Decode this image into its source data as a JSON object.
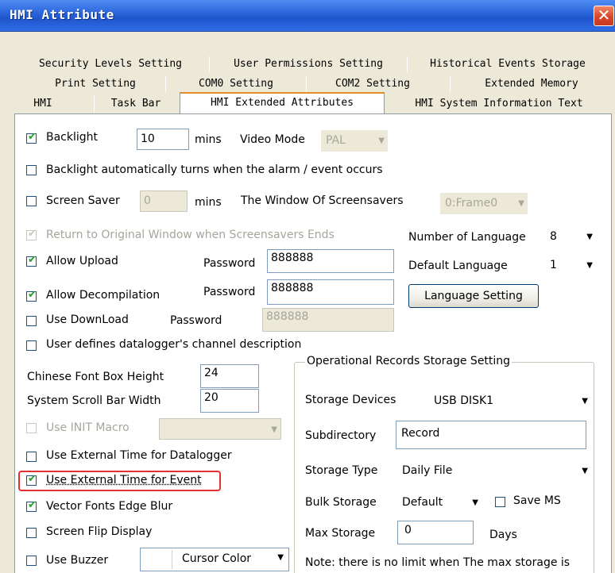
{
  "window": {
    "title": "HMI Attribute",
    "close_glyph": "✕"
  },
  "tabs": {
    "row1": [
      "Security Levels Setting",
      "User Permissions Setting",
      "Historical Events Storage"
    ],
    "row2": [
      "Print Setting",
      "COM0 Setting",
      "COM2 Setting",
      "Extended Memory"
    ],
    "row3": [
      "HMI",
      "Task Bar",
      "HMI Extended Attributes",
      "HMI System Information Text"
    ],
    "active": "HMI Extended Attributes"
  },
  "form": {
    "backlight": {
      "label": "Backlight",
      "checked": true,
      "value": "10",
      "unit": "mins"
    },
    "video_mode": {
      "label": "Video Mode",
      "value": "PAL"
    },
    "backlight_alarm": {
      "label": "Backlight automatically turns when the alarm / event occurs",
      "checked": false
    },
    "screen_saver": {
      "label": "Screen Saver",
      "checked": false,
      "value": "0",
      "unit": "mins"
    },
    "window_of_screensavers": {
      "label": "The Window Of Screensavers",
      "value": "0:Frame0"
    },
    "return_original": {
      "label": "Return to Original Window when Screensavers Ends",
      "checked": true
    },
    "number_of_language": {
      "label": "Number of Language",
      "value": "8"
    },
    "allow_upload": {
      "label": "Allow Upload",
      "checked": true,
      "password_label": "Password",
      "password": "888888"
    },
    "default_language": {
      "label": "Default Language",
      "value": "1"
    },
    "allow_decompilation": {
      "label": "Allow Decompilation",
      "checked": true,
      "password_label": "Password",
      "password": "888888"
    },
    "language_setting_button": "Language Setting",
    "use_download": {
      "label": "Use DownLoad",
      "checked": false,
      "password_label": "Password",
      "password": "888888"
    },
    "datalogger_channel": {
      "label": "User defines datalogger's channel description",
      "checked": false
    },
    "chinese_font_height": {
      "label": "Chinese Font Box Height",
      "value": "24"
    },
    "scroll_bar_width": {
      "label": "System Scroll Bar Width",
      "value": "20"
    },
    "use_init_macro": {
      "label": "Use INIT Macro",
      "checked": false
    },
    "ext_time_datalogger": {
      "label": "Use External Time for Datalogger",
      "checked": false
    },
    "ext_time_event": {
      "label": "Use External Time for Event",
      "checked": true
    },
    "vector_fonts": {
      "label": "Vector Fonts Edge Blur",
      "checked": true
    },
    "screen_flip": {
      "label": "Screen Flip Display",
      "checked": false
    },
    "use_buzzer": {
      "label": "Use Buzzer",
      "checked": false
    },
    "cursor_color": {
      "label": "Cursor Color"
    }
  },
  "storage": {
    "group_title": "Operational Records Storage Setting",
    "storage_devices": {
      "label": "Storage Devices",
      "value": "USB DISK1"
    },
    "subdirectory": {
      "label": "Subdirectory",
      "value": "Record"
    },
    "storage_type": {
      "label": "Storage Type",
      "value": "Daily File"
    },
    "bulk_storage": {
      "label": "Bulk Storage",
      "value": "Default"
    },
    "save_ms": {
      "label": "Save MS",
      "checked": false
    },
    "max_storage": {
      "label": "Max Storage",
      "value": "0",
      "unit": "Days"
    },
    "note": "Note: there is no limit when The max storage is"
  },
  "colors": {
    "highlight": "#e5302f",
    "title_bar": "#2a62d8",
    "check_mark": "#21a121"
  }
}
